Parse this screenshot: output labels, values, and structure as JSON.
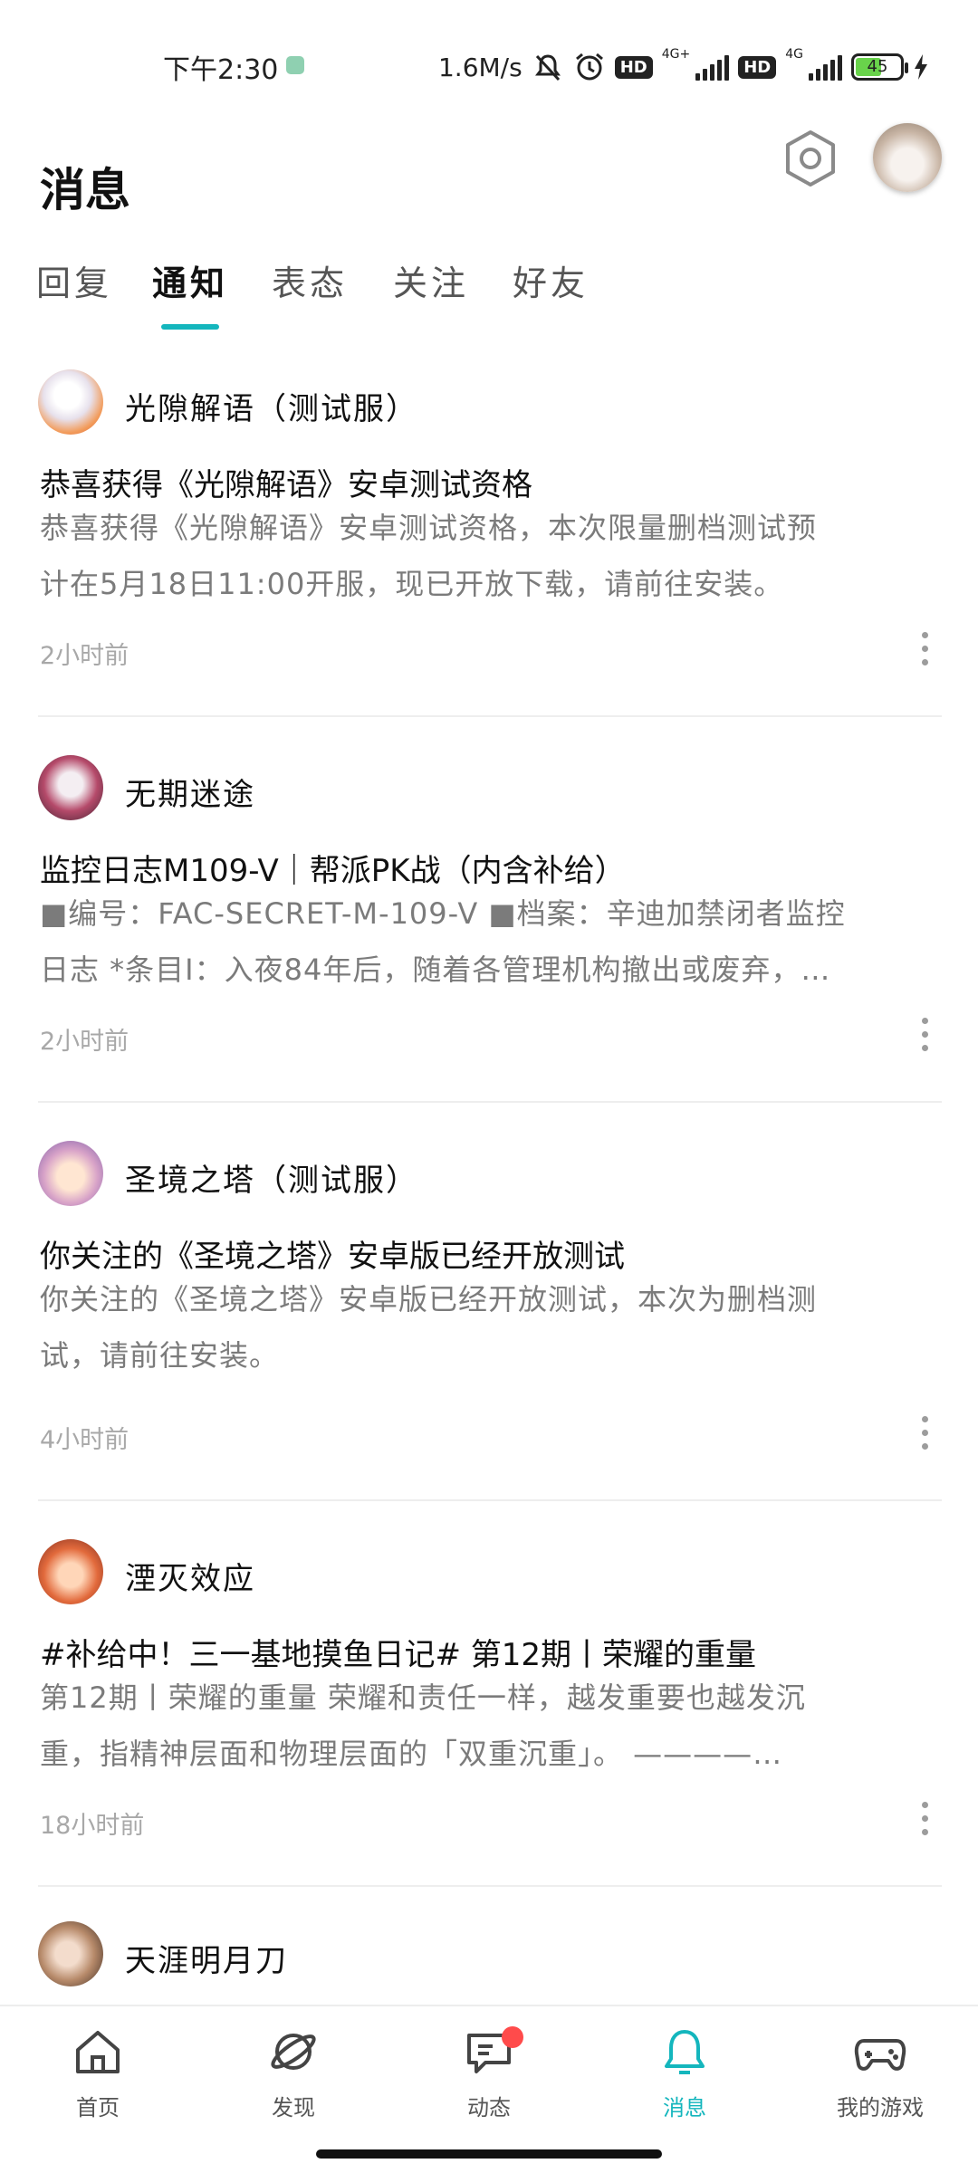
{
  "status_bar": {
    "time": "下午2:30",
    "net_speed": "1.6M/s",
    "hd1": "HD",
    "net1": "4G+",
    "hd2": "HD",
    "net2": "4G",
    "battery": "45",
    "icons": [
      "message-app-icon",
      "mute-icon",
      "alarm-icon",
      "signal-icon",
      "battery-icon",
      "charging-icon"
    ]
  },
  "header": {
    "title": "消息",
    "settings_icon": "settings-hexagon-icon",
    "avatar": "user-avatar-cat"
  },
  "tabs": [
    {
      "label": "回复",
      "active": false
    },
    {
      "label": "通知",
      "active": true
    },
    {
      "label": "表态",
      "active": false
    },
    {
      "label": "关注",
      "active": false
    },
    {
      "label": "好友",
      "active": false
    }
  ],
  "notifications": [
    {
      "sender": "光隙解语（测试服）",
      "headline": "恭喜获得《光隙解语》安卓测试资格",
      "body_line1": "恭喜获得《光隙解语》安卓测试资格，本次限量删档测试预",
      "body_line2": "计在5月18日11:00开服，现已开放下载，请前往安装。",
      "time": "2小时前"
    },
    {
      "sender": "无期迷途",
      "headline": "监控日志M109-V｜帮派PK战（内含补给）",
      "body_line1": "■编号：FAC-SECRET-M-109-V ■档案：辛迪加禁闭者监控",
      "body_line2": "日志 *条目I：入夜84年后，随着各管理机构撤出或废弃，…",
      "time": "2小时前"
    },
    {
      "sender": "圣境之塔（测试服）",
      "headline": "你关注的《圣境之塔》安卓版已经开放测试",
      "body_line1": "你关注的《圣境之塔》安卓版已经开放测试，本次为删档测",
      "body_line2": "试，请前往安装。",
      "time": "4小时前"
    },
    {
      "sender": "湮灭效应",
      "headline": "#补给中！三一基地摸鱼日记# 第12期丨荣耀的重量",
      "body_line1": "第12期丨荣耀的重量 荣耀和责任一样，越发重要也越发沉",
      "body_line2": "重，指精神层面和物理层面的「双重沉重」。 ————…",
      "time": "18小时前"
    },
    {
      "sender": "天涯明月刀",
      "headline": "",
      "body_line1": "",
      "body_line2": "",
      "time": ""
    }
  ],
  "bottom_nav": [
    {
      "label": "首页",
      "icon": "home-icon",
      "active": false
    },
    {
      "label": "发现",
      "icon": "discover-planet-icon",
      "active": false
    },
    {
      "label": "动态",
      "icon": "feed-chat-icon",
      "active": false,
      "badge": true
    },
    {
      "label": "消息",
      "icon": "bell-icon",
      "active": true
    },
    {
      "label": "我的游戏",
      "icon": "gamepad-icon",
      "active": false
    }
  ],
  "colors": {
    "accent": "#14b6bd",
    "secondary_text": "#7b7b7b",
    "time_text": "#a8a8a8",
    "badge": "#ff4b4b"
  }
}
